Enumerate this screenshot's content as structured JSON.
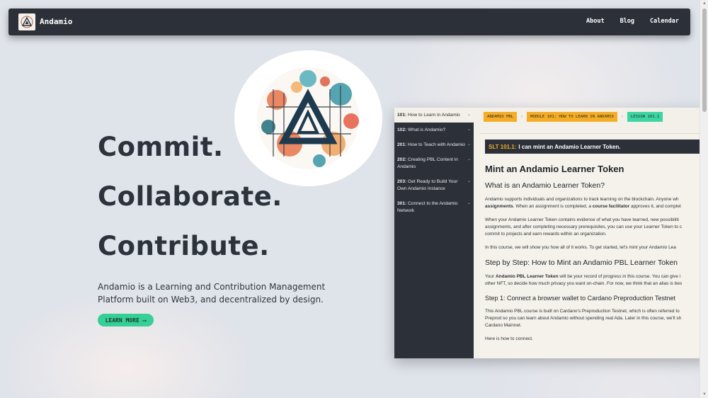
{
  "nav": {
    "brand": "Andamio",
    "links": [
      "About",
      "Blog",
      "Calendar"
    ]
  },
  "hero": {
    "headlines": [
      "Commit.",
      "Collaborate.",
      "Contribute."
    ],
    "tagline": "Andamio is a Learning and Contribution Management Platform built on Web3, and decentralized by design.",
    "cta_label": "LEARN MORE ⟶"
  },
  "app_preview": {
    "sidebar": [
      {
        "code": "101:",
        "label": "How to Learn in Andamio"
      },
      {
        "code": "102:",
        "label": "What is Andamio?"
      },
      {
        "code": "201:",
        "label": "How to Teach with Andamio"
      },
      {
        "code": "202:",
        "label": "Creating PBL Content in Andamio"
      },
      {
        "code": "203:",
        "label": "Get Ready to Build Your Own Andamio Instance"
      },
      {
        "code": "301:",
        "label": "Connect to the Andamio Network"
      }
    ],
    "breadcrumbs": [
      "ANDAMIO PBL",
      "MODULE 101: HOW TO LEARN IN ANDAMIO",
      "LESSON 101.1"
    ],
    "slt": {
      "label": "SLT 101.1:",
      "text": "I can mint an Andamio Learner Token."
    },
    "title": "Mint an Andamio Learner Token",
    "subtitle": "What is an Andamio Learner Token?",
    "p1_a": "Andamio supports individuals and organizations to track learning on the blockchain. Anyone wh",
    "p1_b": "assignments",
    "p1_c": ". When an assignment is completed, a ",
    "p1_d": "course facilitator",
    "p1_e": " approves it, and complet",
    "p2_a": "When your Andamio Learner Token contains evidence of what you have learned, new possibiliti",
    "p2_b": "assignments, and after completing necessary prerequisites, you can use your Learner Token to c",
    "p2_c": "commit to projects and earn rewards within an organization.",
    "p3": "In this course, we will show you how all of it works. To get started, let's mint your Andamio Lea",
    "step_heading": "Step by Step: How to Mint an Andamio PBL Learner Token",
    "p4_a": "Your ",
    "p4_b": "Andamio PBL Learner Token",
    "p4_c": " will be your record of progress in this course. You can give i",
    "p4_d": "other NFT, so decide how much privacy you want on-chain. For now, we think that an alias is bes",
    "step1": "Step 1: Connect a browser wallet to Cardano Preproduction Testnet",
    "p5_a": "This Andamio PBL course is built on Cardano's Preproduction Testnet, which is often referred to",
    "p5_b": "Preprod so you can learn about Andamio without spending real Ada. Later in this course, we'll sh",
    "p5_c": "Cardano Mainnet.",
    "p6": "Here is how to connect."
  },
  "colors": {
    "navbar": "#2c3038",
    "accent_green": "#35cf97",
    "accent_orange": "#f5ad26",
    "page_bg": "#dfe3ea"
  }
}
